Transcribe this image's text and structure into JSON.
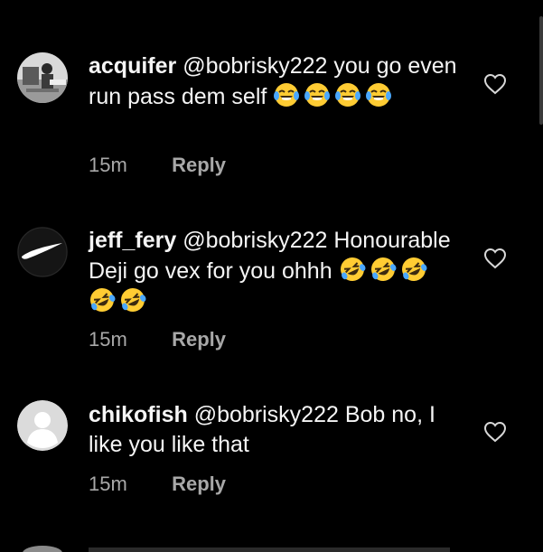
{
  "comments": [
    {
      "username": "acquifer",
      "text": "@bobrisky222 you go even run pass dem self",
      "emoji_after_text": [
        "tears-of-joy",
        "tears-of-joy",
        "tears-of-joy",
        "tears-of-joy"
      ],
      "time": "15m",
      "reply_label": "Reply",
      "avatar": "photo-avatar"
    },
    {
      "username": "jeff_fery",
      "text": "@bobrisky222 Honourable Deji go vex for you ohhh",
      "emoji_after_text": [
        "rolling-laughing",
        "rolling-laughing",
        "rolling-laughing",
        "rolling-laughing",
        "rolling-laughing"
      ],
      "time": "15m",
      "reply_label": "Reply",
      "avatar": "nike-logo-avatar"
    },
    {
      "username": "chikofish",
      "text": "@bobrisky222 Bob no, I like you like that",
      "emoji_after_text": [],
      "time": "15m",
      "reply_label": "Reply",
      "avatar": "default-avatar"
    }
  ],
  "colors": {
    "background": "#000000",
    "text_primary": "#f5f5f5",
    "text_secondary": "#a8a8a8",
    "emoji_face": "#ffcc33",
    "emoji_tear": "#4aa8ff"
  }
}
